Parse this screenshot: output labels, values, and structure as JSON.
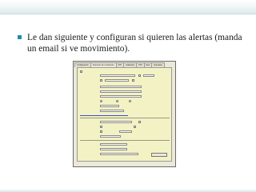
{
  "slide": {
    "bullet_text": "Le dan siguiente y configuran si quieren las alertas (manda un email si ve movimiento).",
    "accent_color": "#1f8fa3",
    "bullet_icon": "square-bullet-icon"
  },
  "dialog": {
    "tabs": [
      "Configuración",
      "Detección de movimiento",
      "FTP",
      "Grabación",
      "PTZ",
      "Red",
      "Avanzado"
    ],
    "active_tab_index": 1
  }
}
